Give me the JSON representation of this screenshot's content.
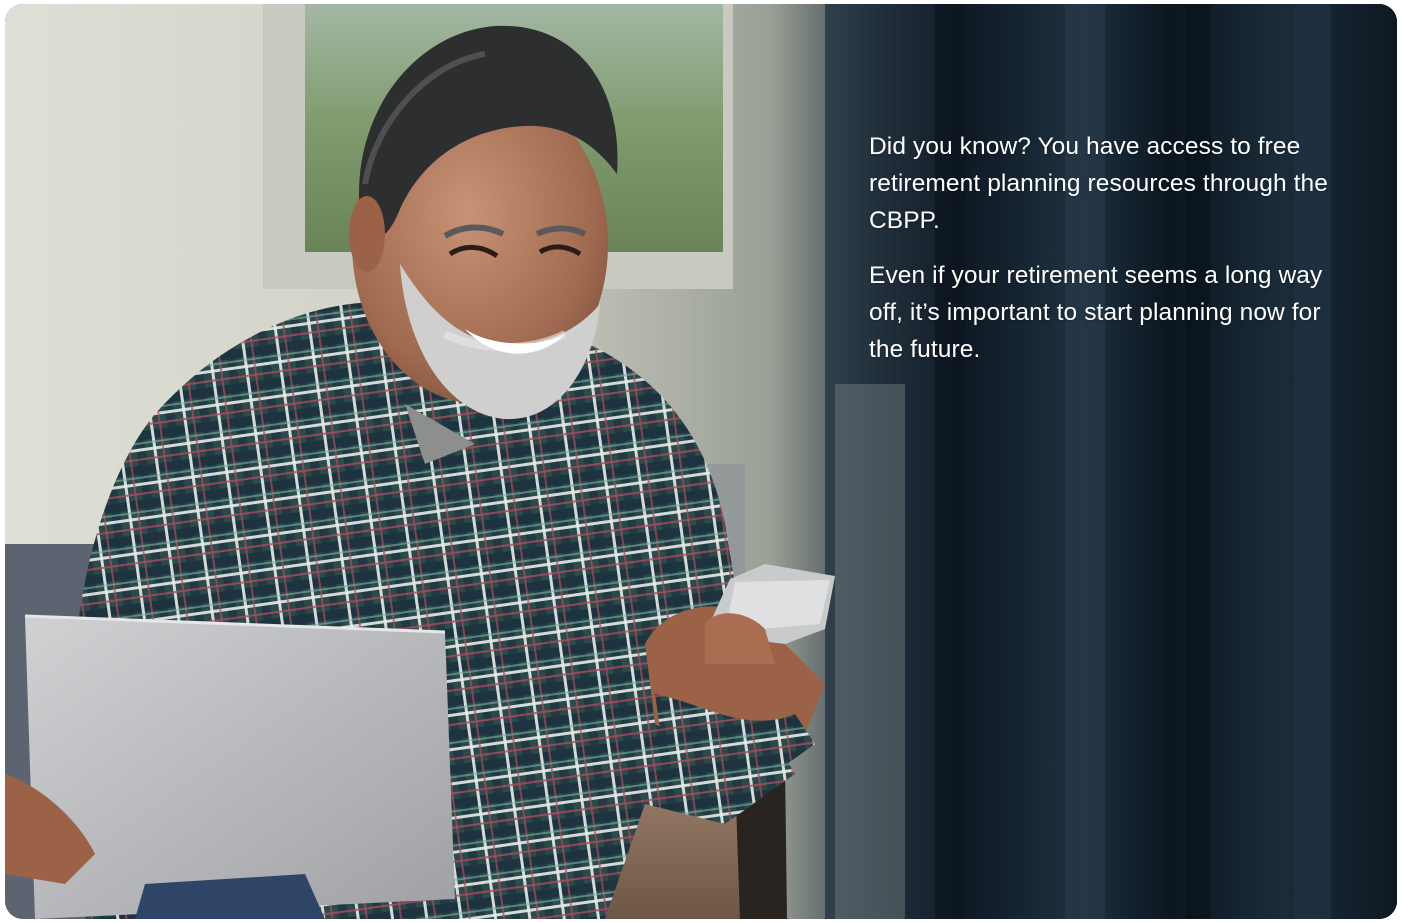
{
  "hero": {
    "image": {
      "icon": "retiree-with-laptop-and-phone-photo",
      "colors": {
        "wall_light": "#dcdcd2",
        "window_green": "#8aa37a",
        "dark_curtain": "#142230",
        "shirt_plaid": "#2f4d4c",
        "laptop_silver": "#b9babc"
      }
    },
    "paragraph_1": "Did you know? You have access to free retirement planning resources through the CBPP.",
    "paragraph_2": "Even if your retirement seems a long way off, it’s important to start planning now for the future."
  }
}
